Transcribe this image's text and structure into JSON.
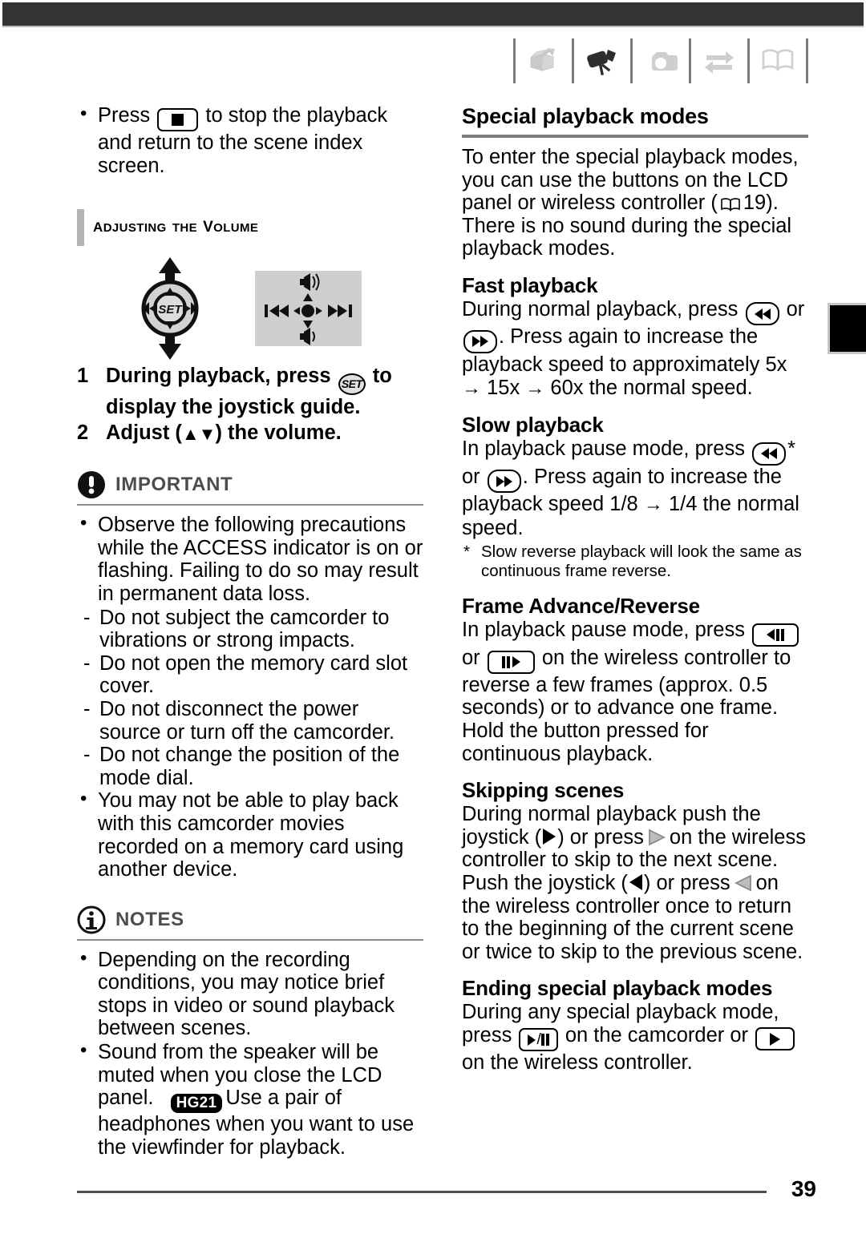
{
  "header": {
    "icons": [
      {
        "name": "unboxing-icon",
        "label": "Getting started"
      },
      {
        "name": "camcorder-icon",
        "label": "Video"
      },
      {
        "name": "photo-camera-icon",
        "label": "Photos"
      },
      {
        "name": "transfer-arrows-icon",
        "label": "External connections"
      },
      {
        "name": "open-book-icon",
        "label": "Additional information"
      }
    ]
  },
  "left_column": {
    "intro_bullet": {
      "pre": "Press",
      "button": "stop-button",
      "post": "to stop the playback and return to the scene index screen."
    },
    "section_heading": "Adjusting the Volume",
    "figures": {
      "joystick_label": "SET",
      "guide_icons": [
        "volume-up",
        "rewind",
        "joystick-center",
        "fast-forward",
        "volume-down"
      ]
    },
    "steps": [
      {
        "num": "1",
        "pre": "During playback, press",
        "icon": "SET",
        "post": "to display the joystick guide."
      },
      {
        "num": "2",
        "pre": "Adjust (",
        "icon": "up-down-arrows",
        "post": ") the volume."
      }
    ],
    "important": {
      "title": "IMPORTANT",
      "bullets": [
        "Observe the following precautions while the ACCESS indicator is on or flashing. Failing to do so may result in permanent data loss.",
        "You may not be able to play back with this camcorder movies recorded on a memory card using another device."
      ],
      "sub_bullets": [
        "Do not subject the camcorder to vibrations or strong impacts.",
        "Do not open the memory card slot cover.",
        "Do not disconnect the power source or turn off the camcorder.",
        "Do not change the position of the mode dial."
      ]
    },
    "notes": {
      "title": "NOTES",
      "bullets": [
        "Depending on the recording conditions, you may notice brief stops in video or sound playback between scenes."
      ],
      "speaker_note": "Sound from the speaker will be muted when you close the LCD panel.",
      "hg_tag": "HG21",
      "hg_note": "Use a pair of headphones when you want to use the viewfinder for playback."
    }
  },
  "right_column": {
    "main_heading": "Special playback modes",
    "intro_a": "To enter the special playback modes, you can use the buttons on the LCD panel or wireless controller (",
    "intro_page_ref": "19",
    "intro_b": "). There is no sound during the special playback modes.",
    "sections": [
      {
        "heading": "Fast playback",
        "text_a": "During normal playback, press",
        "text_b": "or",
        "text_c": ". Press again to increase the playback speed to approximately 5x",
        "text_d": "15x",
        "text_e": "60x the normal speed."
      },
      {
        "heading": "Slow playback",
        "text_a": "In playback pause mode, press",
        "text_b": "* or",
        "text_c": ". Press again to increase the playback speed 1/8",
        "text_d": "1/4 the normal speed.",
        "footnote": "Slow reverse playback will look the same as continuous frame reverse."
      },
      {
        "heading": "Frame Advance/Reverse",
        "text_a": "In playback pause mode, press",
        "text_b": "or",
        "text_c": "on the wireless controller to reverse a few frames (approx. 0.5 seconds) or to advance one frame. Hold the button pressed for continuous playback."
      },
      {
        "heading": "Skipping scenes",
        "text_a": "During normal playback push the joystick (",
        "text_b": ") or press",
        "text_c": "on the wireless controller to skip to the next scene. Push the joystick (",
        "text_d": ") or press",
        "text_e": "on the wireless controller once to return to the beginning of the current scene or twice to skip to the previous scene."
      },
      {
        "heading": "Ending special playback modes",
        "text_a": "During any special playback mode, press",
        "text_b": "on the camcorder or",
        "text_c": "on the wireless controller."
      }
    ]
  },
  "footer": {
    "page_number": "39"
  },
  "colors": {
    "topbar": "#333333",
    "rule": "#7d7d7d",
    "callout_label": "#4d4d4d",
    "gray_figure_bg": "#cfcfcf",
    "section_bar": "#b3b3b3"
  }
}
